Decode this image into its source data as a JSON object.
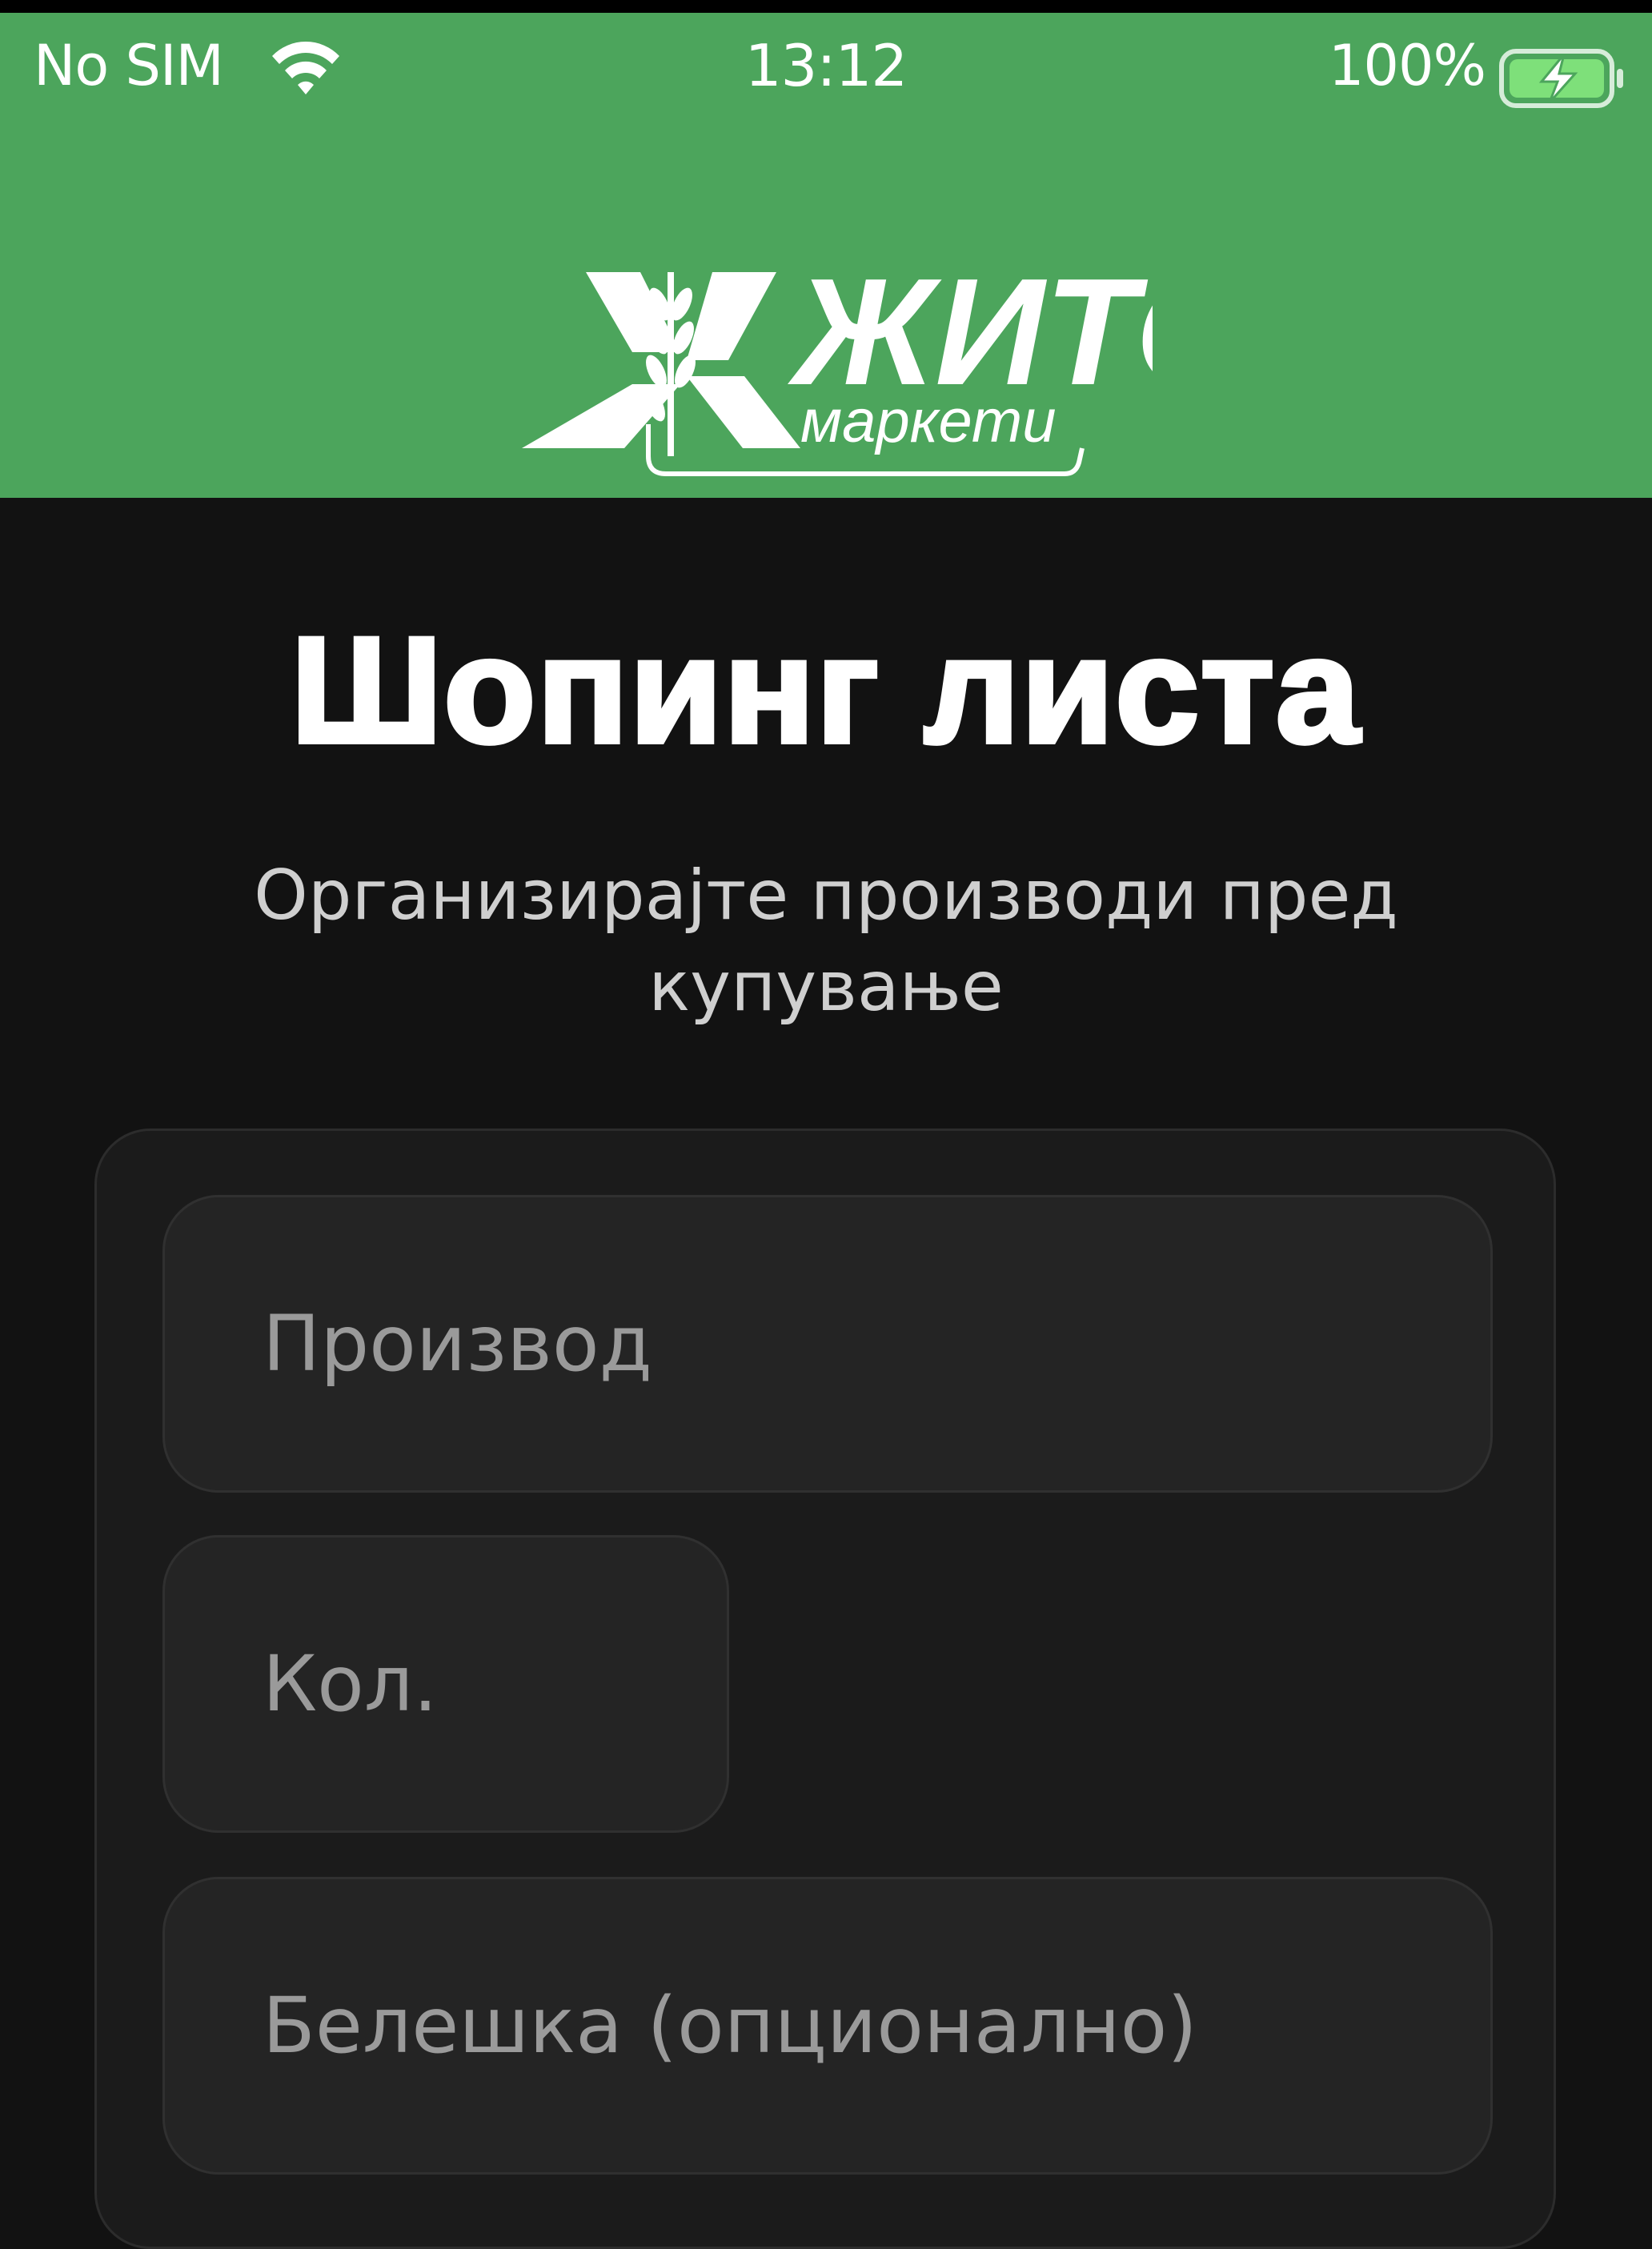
{
  "status_bar": {
    "carrier": "No SIM",
    "time": "13:12",
    "battery": "100%",
    "icons": [
      "wifi-icon",
      "battery-charging-icon"
    ]
  },
  "brand": {
    "logo_text": "ЖИТО",
    "logo_subtext": "маркети",
    "header_color": "#4CA55C"
  },
  "page": {
    "title": "Шопинг листа",
    "subtitle": "Организирајте производи пред купување"
  },
  "form": {
    "product_placeholder": "Производ",
    "quantity_placeholder": "Кол.",
    "note_placeholder": "Белешка (опционално)"
  }
}
